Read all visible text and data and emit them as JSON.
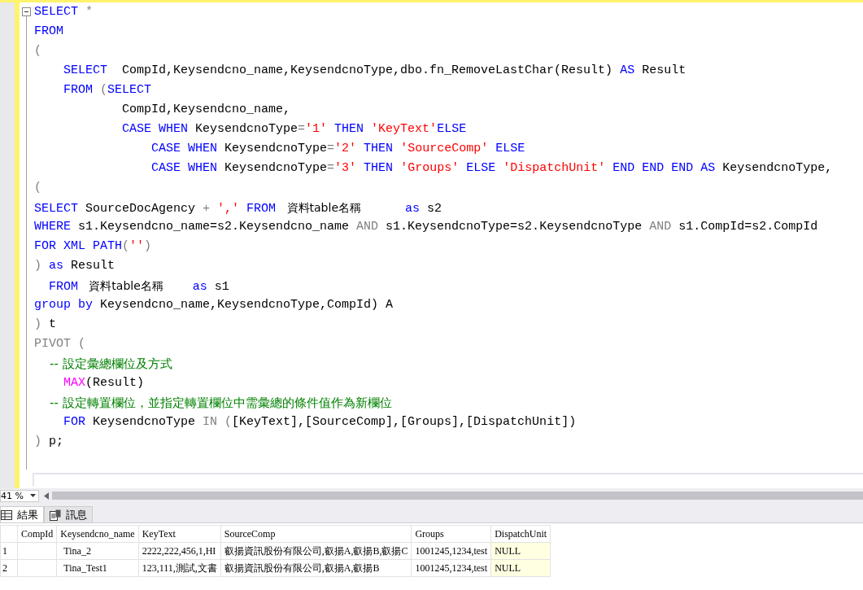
{
  "editor": {
    "lines": [
      [
        {
          "kind": "keyword",
          "text": "SELECT"
        },
        {
          "kind": "operator",
          "text": " *"
        }
      ],
      [
        {
          "kind": "keyword",
          "text": "FROM"
        }
      ],
      [
        {
          "kind": "operator",
          "text": "("
        }
      ],
      [
        {
          "kind": "keyword",
          "text": "    SELECT"
        },
        {
          "kind": "plain",
          "text": "  CompId,Keysendcno_name,KeysendcnoType,dbo.fn_RemoveLastChar(Result) "
        },
        {
          "kind": "keyword",
          "text": "AS"
        },
        {
          "kind": "plain",
          "text": " Result"
        }
      ],
      [
        {
          "kind": "keyword",
          "text": "    FROM"
        },
        {
          "kind": "operator",
          "text": " ("
        },
        {
          "kind": "keyword",
          "text": "SELECT"
        }
      ],
      [
        {
          "kind": "plain",
          "text": "            CompId,Keysendcno_name,"
        }
      ],
      [
        {
          "kind": "keyword",
          "text": "            CASE WHEN"
        },
        {
          "kind": "plain",
          "text": " KeysendcnoType"
        },
        {
          "kind": "operator",
          "text": "="
        },
        {
          "kind": "string",
          "text": "'1'"
        },
        {
          "kind": "keyword",
          "text": " THEN "
        },
        {
          "kind": "string",
          "text": "'KeyText'"
        },
        {
          "kind": "keyword",
          "text": "ELSE"
        }
      ],
      [
        {
          "kind": "keyword",
          "text": "                CASE WHEN"
        },
        {
          "kind": "plain",
          "text": " KeysendcnoType"
        },
        {
          "kind": "operator",
          "text": "="
        },
        {
          "kind": "string",
          "text": "'2'"
        },
        {
          "kind": "keyword",
          "text": " THEN "
        },
        {
          "kind": "string",
          "text": "'SourceComp'"
        },
        {
          "kind": "keyword",
          "text": " ELSE"
        }
      ],
      [
        {
          "kind": "keyword",
          "text": "                CASE WHEN"
        },
        {
          "kind": "plain",
          "text": " KeysendcnoType"
        },
        {
          "kind": "operator",
          "text": "="
        },
        {
          "kind": "string",
          "text": "'3'"
        },
        {
          "kind": "keyword",
          "text": " THEN "
        },
        {
          "kind": "string",
          "text": "'Groups'"
        },
        {
          "kind": "keyword",
          "text": " ELSE "
        },
        {
          "kind": "string",
          "text": "'DispatchUnit'"
        },
        {
          "kind": "keyword",
          "text": " END END END AS"
        },
        {
          "kind": "plain",
          "text": " KeysendcnoType,"
        }
      ],
      [
        {
          "kind": "operator",
          "text": "("
        }
      ],
      [
        {
          "kind": "keyword",
          "text": "SELECT"
        },
        {
          "kind": "plain",
          "text": " SourceDocAgency "
        },
        {
          "kind": "operator",
          "text": "+"
        },
        {
          "kind": "string",
          "text": " ','"
        },
        {
          "kind": "keyword",
          "text": " FROM "
        },
        {
          "kind": "table-name",
          "text": " 資料table名稱"
        },
        {
          "kind": "keyword",
          "text": "      as"
        },
        {
          "kind": "plain",
          "text": " s2"
        }
      ],
      [
        {
          "kind": "keyword",
          "text": "WHERE"
        },
        {
          "kind": "plain",
          "text": " s1.Keysendcno_name=s2.Keysendcno_name "
        },
        {
          "kind": "operator",
          "text": "AND"
        },
        {
          "kind": "plain",
          "text": " s1.KeysendcnoType=s2.KeysendcnoType "
        },
        {
          "kind": "operator",
          "text": "AND"
        },
        {
          "kind": "plain",
          "text": " s1.CompId=s2.CompId"
        }
      ],
      [
        {
          "kind": "keyword",
          "text": "FOR XML PATH"
        },
        {
          "kind": "operator",
          "text": "("
        },
        {
          "kind": "string",
          "text": "''"
        },
        {
          "kind": "operator",
          "text": ")"
        }
      ],
      [
        {
          "kind": "operator",
          "text": ")"
        },
        {
          "kind": "keyword",
          "text": " as"
        },
        {
          "kind": "plain",
          "text": " Result"
        }
      ],
      [
        {
          "kind": "keyword",
          "text": "  FROM"
        },
        {
          "kind": "table-name",
          "text": "   資料table名稱"
        },
        {
          "kind": "keyword",
          "text": "    as"
        },
        {
          "kind": "plain",
          "text": " s1"
        }
      ],
      [
        {
          "kind": "keyword",
          "text": "group by"
        },
        {
          "kind": "plain",
          "text": " Keysendcno_name,KeysendcnoType,CompId) A"
        }
      ],
      [
        {
          "kind": "operator",
          "text": ")"
        },
        {
          "kind": "plain",
          "text": " t"
        }
      ],
      [
        {
          "kind": "operator",
          "text": "PIVOT ("
        }
      ],
      [
        {
          "kind": "comment",
          "text": "    -- 設定彙總欄位及方式"
        }
      ],
      [
        {
          "kind": "function",
          "text": "    MAX"
        },
        {
          "kind": "plain",
          "text": "(Result)"
        }
      ],
      [
        {
          "kind": "comment",
          "text": "    -- 設定轉置欄位，並指定轉置欄位中需彙總的條件值作為新欄位"
        }
      ],
      [
        {
          "kind": "keyword",
          "text": "    FOR"
        },
        {
          "kind": "plain",
          "text": " KeysendcnoType "
        },
        {
          "kind": "operator",
          "text": "IN ("
        },
        {
          "kind": "plain",
          "text": "[KeyText],[SourceComp],[Groups],[DispatchUnit])"
        }
      ],
      [
        {
          "kind": "operator",
          "text": ")"
        },
        {
          "kind": "plain",
          "text": " p;"
        }
      ]
    ]
  },
  "zoom": {
    "value": "41 %"
  },
  "result_tabs": [
    {
      "label": "結果",
      "selected": true,
      "kind": "grid"
    },
    {
      "label": "訊息",
      "selected": false,
      "kind": "messages"
    }
  ],
  "grid": {
    "columns": [
      "CompId",
      "Keysendcno_name",
      "KeyText",
      "SourceComp",
      "Groups",
      "DispatchUnit"
    ],
    "rows": [
      {
        "number": "1",
        "cells": [
          {
            "is_null": false
          },
          {
            "text": "Tina_2",
            "is_null": false
          },
          {
            "text": "2222,222,456,1,HI",
            "is_null": false
          },
          {
            "text": "叡揚資訊股份有限公司,叡揚A,叡揚B,叡揚C",
            "is_null": false
          },
          {
            "text": "1001245,1234,test",
            "is_null": false
          },
          {
            "text": "NULL",
            "is_null": true
          }
        ]
      },
      {
        "number": "2",
        "cells": [
          {
            "is_null": false
          },
          {
            "text": "Tina_Test1",
            "is_null": false
          },
          {
            "text": "123,111,測試,文書",
            "is_null": false
          },
          {
            "text": "叡揚資訊股份有限公司,叡揚A,叡揚B",
            "is_null": false
          },
          {
            "text": "1001245,1234,test",
            "is_null": false
          },
          {
            "text": "NULL",
            "is_null": true
          }
        ]
      }
    ]
  }
}
